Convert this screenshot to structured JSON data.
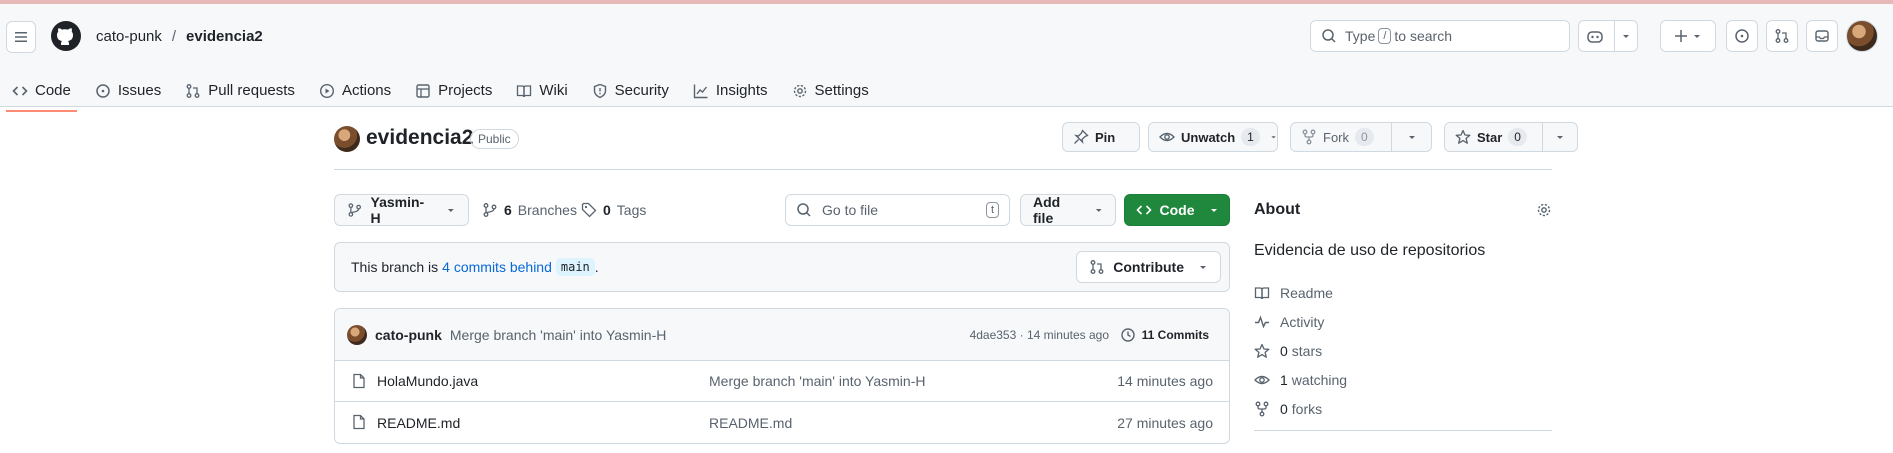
{
  "header": {
    "owner": "cato-punk",
    "separator": "/",
    "repo": "evidencia2",
    "search_prefix": "Type",
    "search_key": "/",
    "search_suffix": "to search"
  },
  "tabs": [
    {
      "label": "Code",
      "icon": "code-icon"
    },
    {
      "label": "Issues",
      "icon": "issue-icon"
    },
    {
      "label": "Pull requests",
      "icon": "pull-request-icon"
    },
    {
      "label": "Actions",
      "icon": "play-icon"
    },
    {
      "label": "Projects",
      "icon": "table-icon"
    },
    {
      "label": "Wiki",
      "icon": "book-icon"
    },
    {
      "label": "Security",
      "icon": "shield-icon"
    },
    {
      "label": "Insights",
      "icon": "graph-icon"
    },
    {
      "label": "Settings",
      "icon": "gear-icon"
    }
  ],
  "repo_header": {
    "name": "evidencia2",
    "visibility": "Public",
    "pin_label": "Pin",
    "watch_label": "Unwatch",
    "watch_count": "1",
    "fork_label": "Fork",
    "fork_count": "0",
    "star_label": "Star",
    "star_count": "0"
  },
  "toolbar": {
    "branch": "Yasmin-H",
    "branches_count": "6",
    "branches_label": "Branches",
    "tags_count": "0",
    "tags_label": "Tags",
    "goto_placeholder": "Go to file",
    "goto_key": "t",
    "add_file_label": "Add file",
    "code_label": "Code"
  },
  "branch_status": {
    "prefix": "This branch is",
    "link": "4 commits behind",
    "base": "main",
    "suffix": ".",
    "contribute_label": "Contribute"
  },
  "last_commit": {
    "author": "cato-punk",
    "message": "Merge branch 'main' into Yasmin-H",
    "meta": "4dae353 · 14 minutes ago",
    "commits_label": "11 Commits"
  },
  "files": [
    {
      "name": "HolaMundo.java",
      "message": "Merge branch 'main' into Yasmin-H",
      "time": "14 minutes ago"
    },
    {
      "name": "README.md",
      "message": "README.md",
      "time": "27 minutes ago"
    }
  ],
  "about": {
    "title": "About",
    "description": "Evidencia de uso de repositorios",
    "readme": "Readme",
    "activity": "Activity",
    "stars_count": "0",
    "stars_label": "stars",
    "watching_count": "1",
    "watching_label": "watching",
    "forks_count": "0",
    "forks_label": "forks"
  },
  "colors": {
    "accent_green": "#1f883d",
    "link_blue": "#0969da",
    "tab_underline": "#fd8c73"
  }
}
